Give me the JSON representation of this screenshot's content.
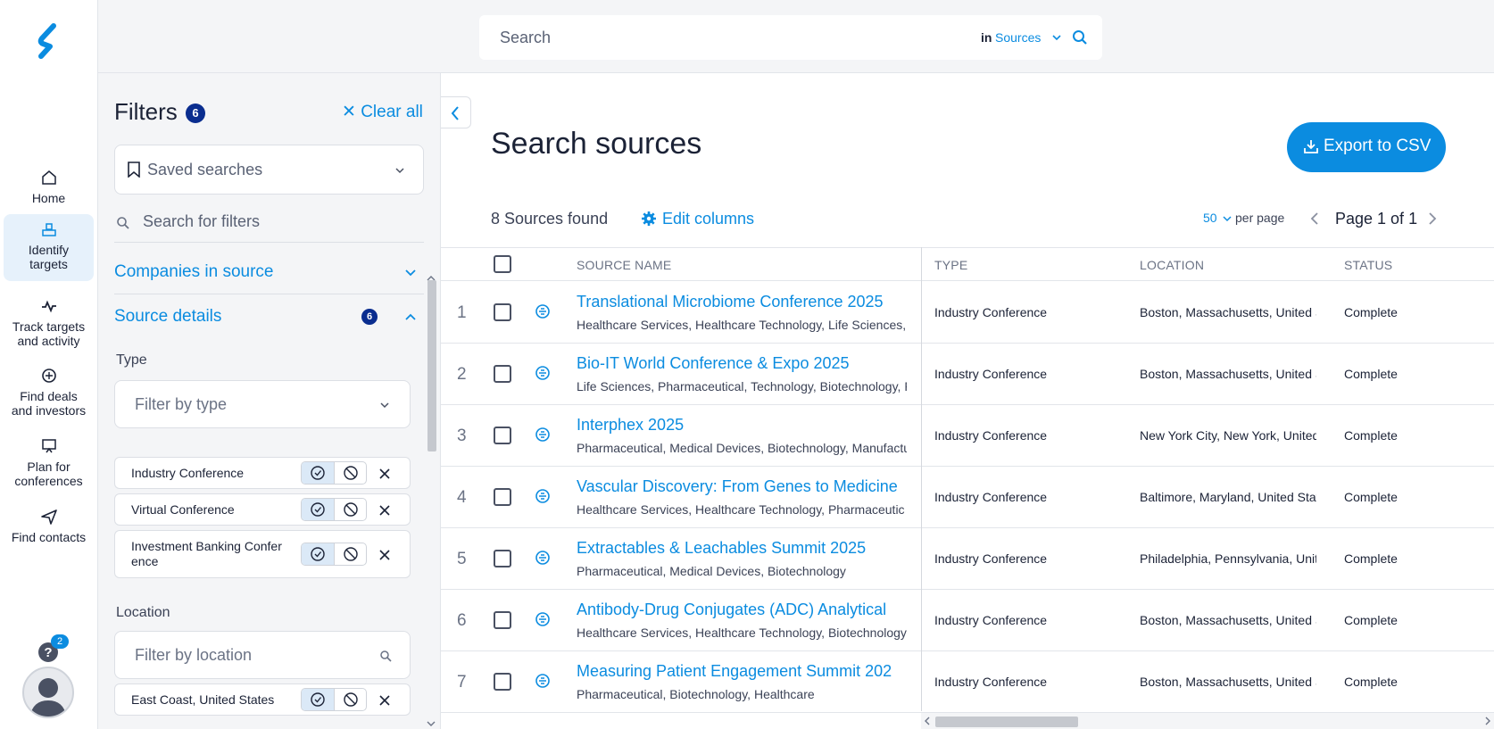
{
  "nav": {
    "items": [
      {
        "label_1": "Home",
        "label_2": "",
        "icon": "home-icon"
      },
      {
        "label_1": "Identify",
        "label_2": "targets",
        "icon": "identify-targets-icon"
      },
      {
        "label_1": "Track targets",
        "label_2": "and activity",
        "icon": "activity-icon"
      },
      {
        "label_1": "Find deals",
        "label_2": "and investors",
        "icon": "deals-icon"
      },
      {
        "label_1": "Plan for",
        "label_2": "conferences",
        "icon": "conference-icon"
      },
      {
        "label_1": "Find contacts",
        "label_2": "",
        "icon": "send-icon"
      }
    ],
    "help_badge": "2"
  },
  "search": {
    "placeholder": "Search",
    "in_label": "in",
    "scope": "Sources"
  },
  "filters": {
    "title": "Filters",
    "count": "6",
    "clear_all": "Clear all",
    "saved_searches": "Saved searches",
    "search_filters": "Search for filters",
    "sections": {
      "companies": "Companies in source",
      "source_details": "Source details",
      "source_details_count": "6"
    },
    "type_label": "Type",
    "type_placeholder": "Filter by type",
    "type_chips": [
      {
        "line1": "Industry Conference",
        "line2": ""
      },
      {
        "line1": "Virtual Conference",
        "line2": ""
      },
      {
        "line1": "Investment Banking Confer",
        "line2": "ence"
      }
    ],
    "location_label": "Location",
    "location_placeholder": "Filter by location",
    "location_chips": [
      {
        "line1": "East Coast, United States",
        "line2": ""
      }
    ]
  },
  "main": {
    "title": "Search sources",
    "export": "Export to CSV",
    "found": "8 Sources found",
    "edit_columns": "Edit columns",
    "per_page_value": "50",
    "per_page_label": "per page",
    "page_text": "Page 1 of 1"
  },
  "table": {
    "headers": {
      "name": "SOURCE NAME",
      "type": "TYPE",
      "location": "LOCATION",
      "status": "STATUS"
    },
    "rows": [
      {
        "num": "1",
        "name": "Translational Microbiome Conference 2025",
        "sub": "Healthcare Services, Healthcare Technology, Life Sciences,",
        "type": "Industry Conference",
        "location": "Boston, Massachusetts, United S",
        "status": "Complete"
      },
      {
        "num": "2",
        "name": "Bio-IT World Conference & Expo 2025",
        "sub": "Life Sciences, Pharmaceutical, Technology, Biotechnology, F",
        "type": "Industry Conference",
        "location": "Boston, Massachusetts, United S",
        "status": "Complete"
      },
      {
        "num": "3",
        "name": "Interphex 2025",
        "sub": "Pharmaceutical, Medical Devices, Biotechnology, Manufactu",
        "type": "Industry Conference",
        "location": "New York City, New York, United",
        "status": "Complete"
      },
      {
        "num": "4",
        "name": "Vascular Discovery: From Genes to Medicine",
        "sub": "Healthcare Services, Healthcare Technology, Pharmaceutic",
        "type": "Industry Conference",
        "location": "Baltimore, Maryland, United Stat",
        "status": "Complete"
      },
      {
        "num": "5",
        "name": "Extractables & Leachables Summit 2025",
        "sub": "Pharmaceutical, Medical Devices, Biotechnology",
        "type": "Industry Conference",
        "location": "Philadelphia, Pennsylvania, Unite",
        "status": "Complete"
      },
      {
        "num": "6",
        "name": "Antibody-Drug Conjugates (ADC) Analytical",
        "sub": "Healthcare Services, Healthcare Technology, Biotechnology",
        "type": "Industry Conference",
        "location": "Boston, Massachusetts, United S",
        "status": "Complete"
      },
      {
        "num": "7",
        "name": "Measuring Patient Engagement Summit 202",
        "sub": "Pharmaceutical, Biotechnology, Healthcare",
        "type": "Industry Conference",
        "location": "Boston, Massachusetts, United S",
        "status": "Complete"
      }
    ]
  },
  "colors": {
    "accent": "#0b8ce0",
    "badge": "#0a2d8f",
    "panel": "#f4f5f7"
  }
}
